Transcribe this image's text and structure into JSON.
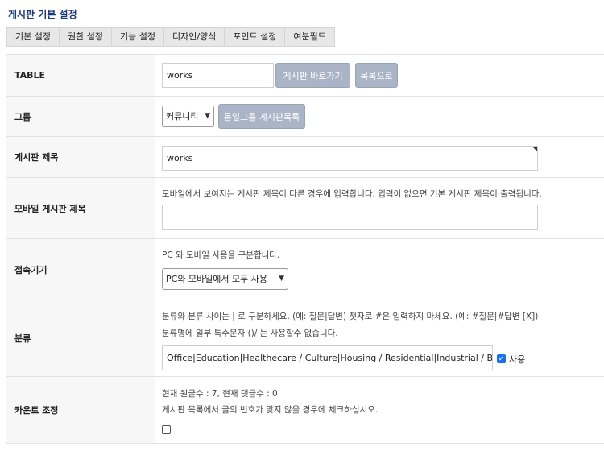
{
  "page": {
    "title": "게시판 기본 설정"
  },
  "tabs": [
    {
      "label": "기본 설정"
    },
    {
      "label": "권한 설정"
    },
    {
      "label": "기능 설정"
    },
    {
      "label": "디자인/양식"
    },
    {
      "label": "포인트 설정"
    },
    {
      "label": "여분필드"
    }
  ],
  "rows": {
    "table": {
      "label": "TABLE",
      "value": "works",
      "goto_button": "게시판 바로가기",
      "list_button": "목록으로"
    },
    "group": {
      "label": "그룹",
      "selected": "커뮤니티",
      "same_group_button": "동일그룹 게시판목록"
    },
    "subject": {
      "label": "게시판 제목",
      "value": "works"
    },
    "mobile_subject": {
      "label": "모바일 게시판 제목",
      "help": "모바일에서 보여지는 게시판 제목이 다른 경우에 입력합니다. 입력이 없으면 기본 게시판 제목이 출력됩니다.",
      "value": ""
    },
    "device": {
      "label": "접속기기",
      "help": "PC 와 모바일 사용을 구분합니다.",
      "selected": "PC와 모바일에서 모두 사용"
    },
    "category": {
      "label": "분류",
      "help1": "분류와 분류 사이는 | 로 구분하세요. (예: 질문|답변) 첫자로 #은 입력하지 마세요. (예: #질문|#답변 [X])",
      "help2": "분류명에 일부 특수문자 ()/ 는 사용할수 없습니다.",
      "value": "Office|Education|Healthecare / Culture|Housing / Residential|Industrial / BTLTK|Mi:",
      "use_label": "사용",
      "use_checked": true
    },
    "count": {
      "label": "카운트 조정",
      "help1": "현재 원글수 : 7, 현재 댓글수 : 0",
      "help2": "게시판 목록에서 글의 번호가 맞지 않을 경우에 체크하십시오."
    }
  }
}
